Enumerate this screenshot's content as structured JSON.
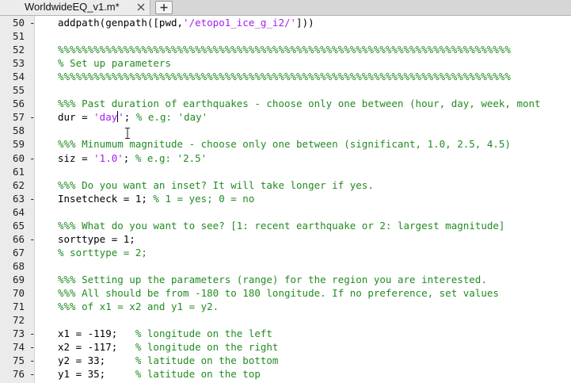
{
  "tab": {
    "title": "WorldwideEQ_v1.m*",
    "close_icon": "close-x",
    "add_icon": "plus"
  },
  "colors": {
    "comment": "#228b22",
    "string": "#a020f0",
    "text": "#000000",
    "gutter": "#ebebeb"
  },
  "lines": [
    {
      "num": "50",
      "dash": "-",
      "code": [
        {
          "t": "addpath(genpath([pwd,",
          "k": "plain"
        },
        {
          "t": "'/etopo1_ice_g_i2/'",
          "k": "string"
        },
        {
          "t": "]))",
          "k": "plain"
        }
      ]
    },
    {
      "num": "51",
      "dash": "",
      "code": []
    },
    {
      "num": "52",
      "dash": "",
      "code": [
        {
          "t": "%%%%%%%%%%%%%%%%%%%%%%%%%%%%%%%%%%%%%%%%%%%%%%%%%%%%%%%%%%%%%%%%%%%%%%%%%%%%",
          "k": "comment"
        }
      ]
    },
    {
      "num": "53",
      "dash": "",
      "code": [
        {
          "t": "% Set up parameters",
          "k": "comment"
        }
      ]
    },
    {
      "num": "54",
      "dash": "",
      "code": [
        {
          "t": "%%%%%%%%%%%%%%%%%%%%%%%%%%%%%%%%%%%%%%%%%%%%%%%%%%%%%%%%%%%%%%%%%%%%%%%%%%%%",
          "k": "comment"
        }
      ]
    },
    {
      "num": "55",
      "dash": "",
      "code": []
    },
    {
      "num": "56",
      "dash": "",
      "code": [
        {
          "t": "%%% Past duration of earthquakes - choose only one between (hour, day, week, mont",
          "k": "comment"
        }
      ]
    },
    {
      "num": "57",
      "dash": "-",
      "code": [
        {
          "t": "dur = ",
          "k": "plain"
        },
        {
          "t": "'day",
          "k": "string"
        },
        {
          "t": "CARET",
          "k": "caret"
        },
        {
          "t": "'",
          "k": "string"
        },
        {
          "t": "; ",
          "k": "plain"
        },
        {
          "t": "% e.g: 'day'",
          "k": "comment"
        }
      ]
    },
    {
      "num": "58",
      "dash": "",
      "code": []
    },
    {
      "num": "59",
      "dash": "",
      "code": [
        {
          "t": "%%% Minumum magnitude - choose only one between (significant, 1.0, 2.5, 4.5)",
          "k": "comment"
        }
      ]
    },
    {
      "num": "60",
      "dash": "-",
      "code": [
        {
          "t": "siz = ",
          "k": "plain"
        },
        {
          "t": "'1.0'",
          "k": "string"
        },
        {
          "t": "; ",
          "k": "plain"
        },
        {
          "t": "% e.g: '2.5'",
          "k": "comment"
        }
      ]
    },
    {
      "num": "61",
      "dash": "",
      "code": []
    },
    {
      "num": "62",
      "dash": "",
      "code": [
        {
          "t": "%%% Do you want an inset? It will take longer if yes.",
          "k": "comment"
        }
      ]
    },
    {
      "num": "63",
      "dash": "-",
      "code": [
        {
          "t": "Insetcheck = 1; ",
          "k": "plain"
        },
        {
          "t": "% 1 = yes; 0 = no",
          "k": "comment"
        }
      ]
    },
    {
      "num": "64",
      "dash": "",
      "code": []
    },
    {
      "num": "65",
      "dash": "",
      "code": [
        {
          "t": "%%% What do you want to see? [1: recent earthquake or 2: largest magnitude]",
          "k": "comment"
        }
      ]
    },
    {
      "num": "66",
      "dash": "-",
      "code": [
        {
          "t": "sorttype = 1;",
          "k": "plain"
        }
      ]
    },
    {
      "num": "67",
      "dash": "",
      "code": [
        {
          "t": "% sorttype = 2;",
          "k": "comment"
        }
      ]
    },
    {
      "num": "68",
      "dash": "",
      "code": []
    },
    {
      "num": "69",
      "dash": "",
      "code": [
        {
          "t": "%%% Setting up the parameters (range) for the region you are interested.",
          "k": "comment"
        }
      ]
    },
    {
      "num": "70",
      "dash": "",
      "code": [
        {
          "t": "%%% All should be from -180 to 180 longitude. If no preference, set values",
          "k": "comment"
        }
      ]
    },
    {
      "num": "71",
      "dash": "",
      "code": [
        {
          "t": "%%% of x1 = x2 and y1 = y2.",
          "k": "comment"
        }
      ]
    },
    {
      "num": "72",
      "dash": "",
      "code": []
    },
    {
      "num": "73",
      "dash": "-",
      "code": [
        {
          "t": "x1 = -119;   ",
          "k": "plain"
        },
        {
          "t": "% longitude on the left",
          "k": "comment"
        }
      ]
    },
    {
      "num": "74",
      "dash": "-",
      "code": [
        {
          "t": "x2 = -117;   ",
          "k": "plain"
        },
        {
          "t": "% longitude on the right",
          "k": "comment"
        }
      ]
    },
    {
      "num": "75",
      "dash": "-",
      "code": [
        {
          "t": "y2 = 33;     ",
          "k": "plain"
        },
        {
          "t": "% latitude on the bottom",
          "k": "comment"
        }
      ]
    },
    {
      "num": "76",
      "dash": "-",
      "code": [
        {
          "t": "y1 = 35;     ",
          "k": "plain"
        },
        {
          "t": "% latitude on the top",
          "k": "comment"
        }
      ]
    }
  ]
}
